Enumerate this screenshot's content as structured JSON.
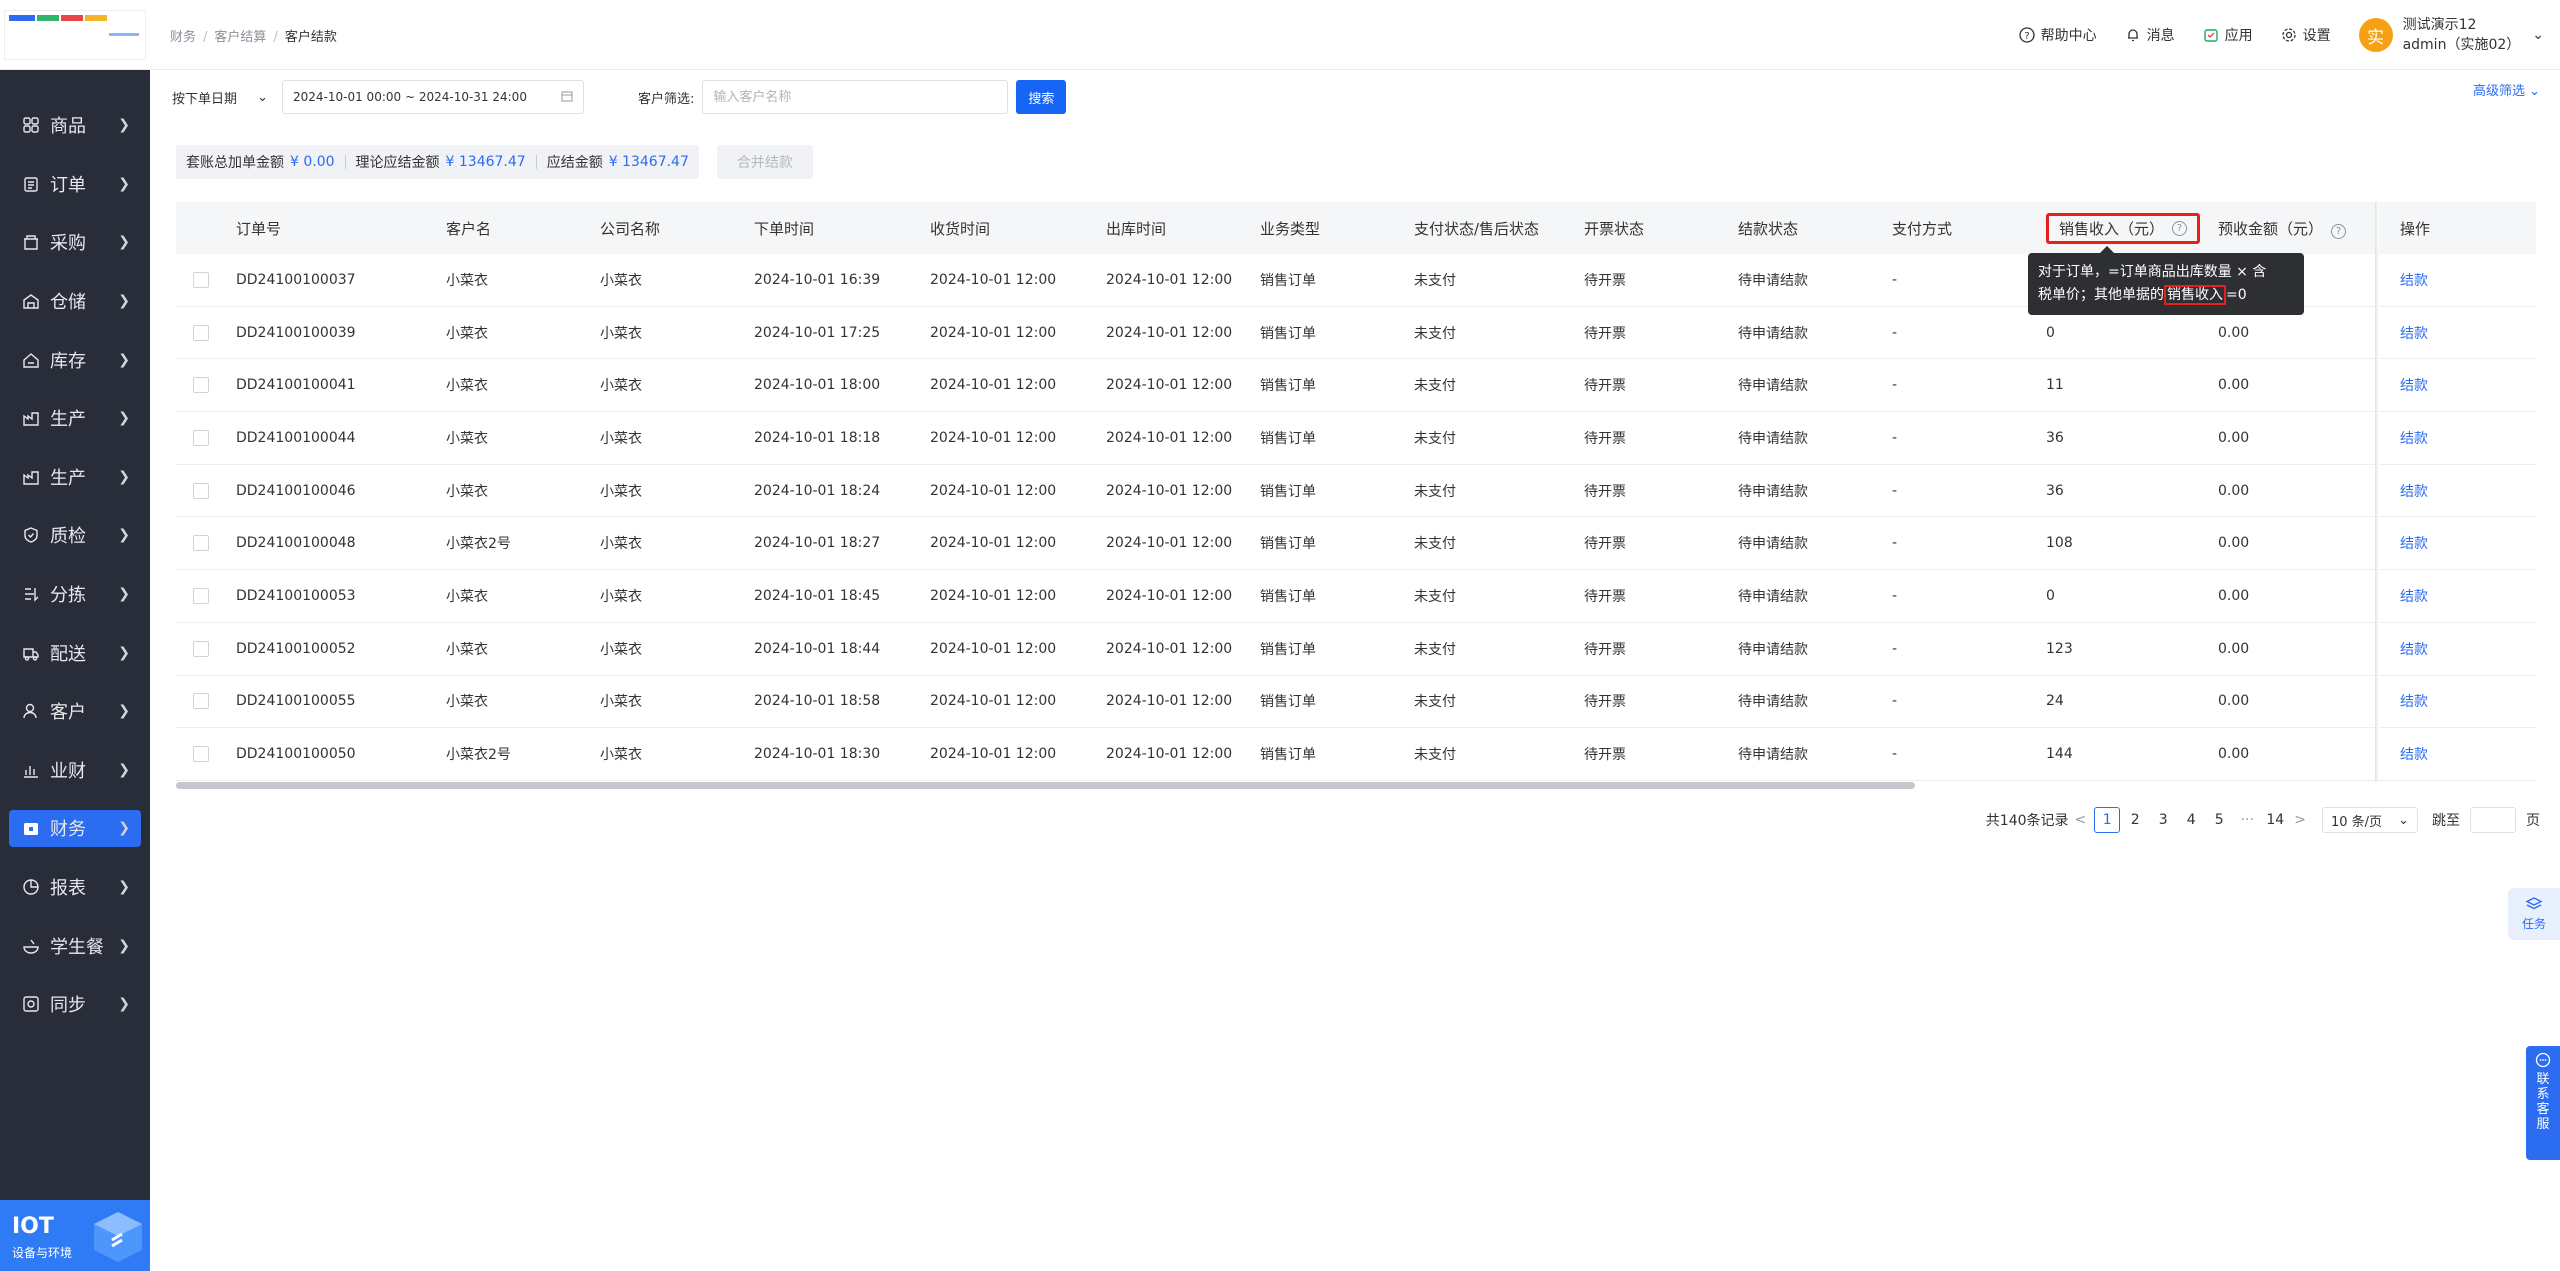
{
  "sidebar": {
    "items": [
      {
        "label": "商品",
        "icon": "grid-icon"
      },
      {
        "label": "订单",
        "icon": "clipboard-icon"
      },
      {
        "label": "采购",
        "icon": "shop-icon"
      },
      {
        "label": "仓储",
        "icon": "warehouse-icon"
      },
      {
        "label": "库存",
        "icon": "stock-icon"
      },
      {
        "label": "生产",
        "icon": "factory-icon"
      },
      {
        "label": "生产",
        "icon": "factory-icon"
      },
      {
        "label": "质检",
        "icon": "shield-icon"
      },
      {
        "label": "分拣",
        "icon": "sort-icon"
      },
      {
        "label": "配送",
        "icon": "truck-icon"
      },
      {
        "label": "客户",
        "icon": "user-icon"
      },
      {
        "label": "业财",
        "icon": "chart-icon"
      },
      {
        "label": "财务",
        "icon": "wallet-icon",
        "active": true
      },
      {
        "label": "报表",
        "icon": "pie-icon"
      },
      {
        "label": "学生餐",
        "icon": "bowl-icon"
      },
      {
        "label": "同步",
        "icon": "sync-icon"
      }
    ],
    "iot": {
      "title": "IOT",
      "subtitle": "设备与环境"
    }
  },
  "breadcrumb": [
    "财务",
    "客户结算",
    "客户结款"
  ],
  "header": {
    "help": "帮助中心",
    "messages": "消息",
    "apps": "应用",
    "settings": "设置",
    "user_name": "测试演示12",
    "user_account": "admin（实施02）",
    "avatar_text": "实"
  },
  "filters": {
    "date_type": "按下单日期",
    "date_range": "2024-10-01 00:00 ~ 2024-10-31 24:00",
    "customer_label": "客户筛选:",
    "customer_placeholder": "输入客户名称",
    "search_label": "搜索",
    "advanced": "高级筛选"
  },
  "summary": {
    "extra_label": "套账总加单金额",
    "extra_value": "¥ 0.00",
    "theory_label": "理论应结金额",
    "theory_value": "¥ 13467.47",
    "due_label": "应结金额",
    "due_value": "¥ 13467.47",
    "merge_label": "合并结款"
  },
  "table": {
    "columns": [
      "订单号",
      "客户名",
      "公司名称",
      "下单时间",
      "收货时间",
      "出库时间",
      "业务类型",
      "支付状态/售后状态",
      "开票状态",
      "结款状态",
      "支付方式",
      "销售收入（元）",
      "预收金额（元）",
      "操作"
    ],
    "rows": [
      [
        "DD24100100037",
        "小菜衣",
        "小菜衣",
        "2024-10-01 16:39",
        "2024-10-01 12:00",
        "2024-10-01 12:00",
        "销售订单",
        "未支付",
        "待开票",
        "待申请结款",
        "-",
        "",
        "",
        "结款"
      ],
      [
        "DD24100100039",
        "小菜衣",
        "小菜衣",
        "2024-10-01 17:25",
        "2024-10-01 12:00",
        "2024-10-01 12:00",
        "销售订单",
        "未支付",
        "待开票",
        "待申请结款",
        "-",
        "0",
        "0.00",
        "结款"
      ],
      [
        "DD24100100041",
        "小菜衣",
        "小菜衣",
        "2024-10-01 18:00",
        "2024-10-01 12:00",
        "2024-10-01 12:00",
        "销售订单",
        "未支付",
        "待开票",
        "待申请结款",
        "-",
        "11",
        "0.00",
        "结款"
      ],
      [
        "DD24100100044",
        "小菜衣",
        "小菜衣",
        "2024-10-01 18:18",
        "2024-10-01 12:00",
        "2024-10-01 12:00",
        "销售订单",
        "未支付",
        "待开票",
        "待申请结款",
        "-",
        "36",
        "0.00",
        "结款"
      ],
      [
        "DD24100100046",
        "小菜衣",
        "小菜衣",
        "2024-10-01 18:24",
        "2024-10-01 12:00",
        "2024-10-01 12:00",
        "销售订单",
        "未支付",
        "待开票",
        "待申请结款",
        "-",
        "36",
        "0.00",
        "结款"
      ],
      [
        "DD24100100048",
        "小菜衣2号",
        "小菜衣",
        "2024-10-01 18:27",
        "2024-10-01 12:00",
        "2024-10-01 12:00",
        "销售订单",
        "未支付",
        "待开票",
        "待申请结款",
        "-",
        "108",
        "0.00",
        "结款"
      ],
      [
        "DD24100100053",
        "小菜衣",
        "小菜衣",
        "2024-10-01 18:45",
        "2024-10-01 12:00",
        "2024-10-01 12:00",
        "销售订单",
        "未支付",
        "待开票",
        "待申请结款",
        "-",
        "0",
        "0.00",
        "结款"
      ],
      [
        "DD24100100052",
        "小菜衣",
        "小菜衣",
        "2024-10-01 18:44",
        "2024-10-01 12:00",
        "2024-10-01 12:00",
        "销售订单",
        "未支付",
        "待开票",
        "待申请结款",
        "-",
        "123",
        "0.00",
        "结款"
      ],
      [
        "DD24100100055",
        "小菜衣",
        "小菜衣",
        "2024-10-01 18:58",
        "2024-10-01 12:00",
        "2024-10-01 12:00",
        "销售订单",
        "未支付",
        "待开票",
        "待申请结款",
        "-",
        "24",
        "0.00",
        "结款"
      ],
      [
        "DD24100100050",
        "小菜衣2号",
        "小菜衣",
        "2024-10-01 18:30",
        "2024-10-01 12:00",
        "2024-10-01 12:00",
        "销售订单",
        "未支付",
        "待开票",
        "待申请结款",
        "-",
        "144",
        "0.00",
        "结款"
      ]
    ]
  },
  "tooltip": {
    "line1": "对于订单，=订单商品出库数量 × 含",
    "line2_a": "税单价；其他单据的",
    "line2_hl": "销售收入",
    "line2_b": "=0"
  },
  "pagination": {
    "total": "共140条记录",
    "pages": [
      "1",
      "2",
      "3",
      "4",
      "5"
    ],
    "ellipsis": "···",
    "last": "14",
    "page_size": "10 条/页",
    "jump_label": "跳至",
    "page_suffix": "页",
    "current": 1
  },
  "widgets": {
    "task": "任务",
    "service": [
      "联",
      "系",
      "客",
      "服"
    ]
  },
  "colors": {
    "primary": "#2b6cf1",
    "sidebar": "#282d39",
    "highlight": "#e5211d"
  }
}
